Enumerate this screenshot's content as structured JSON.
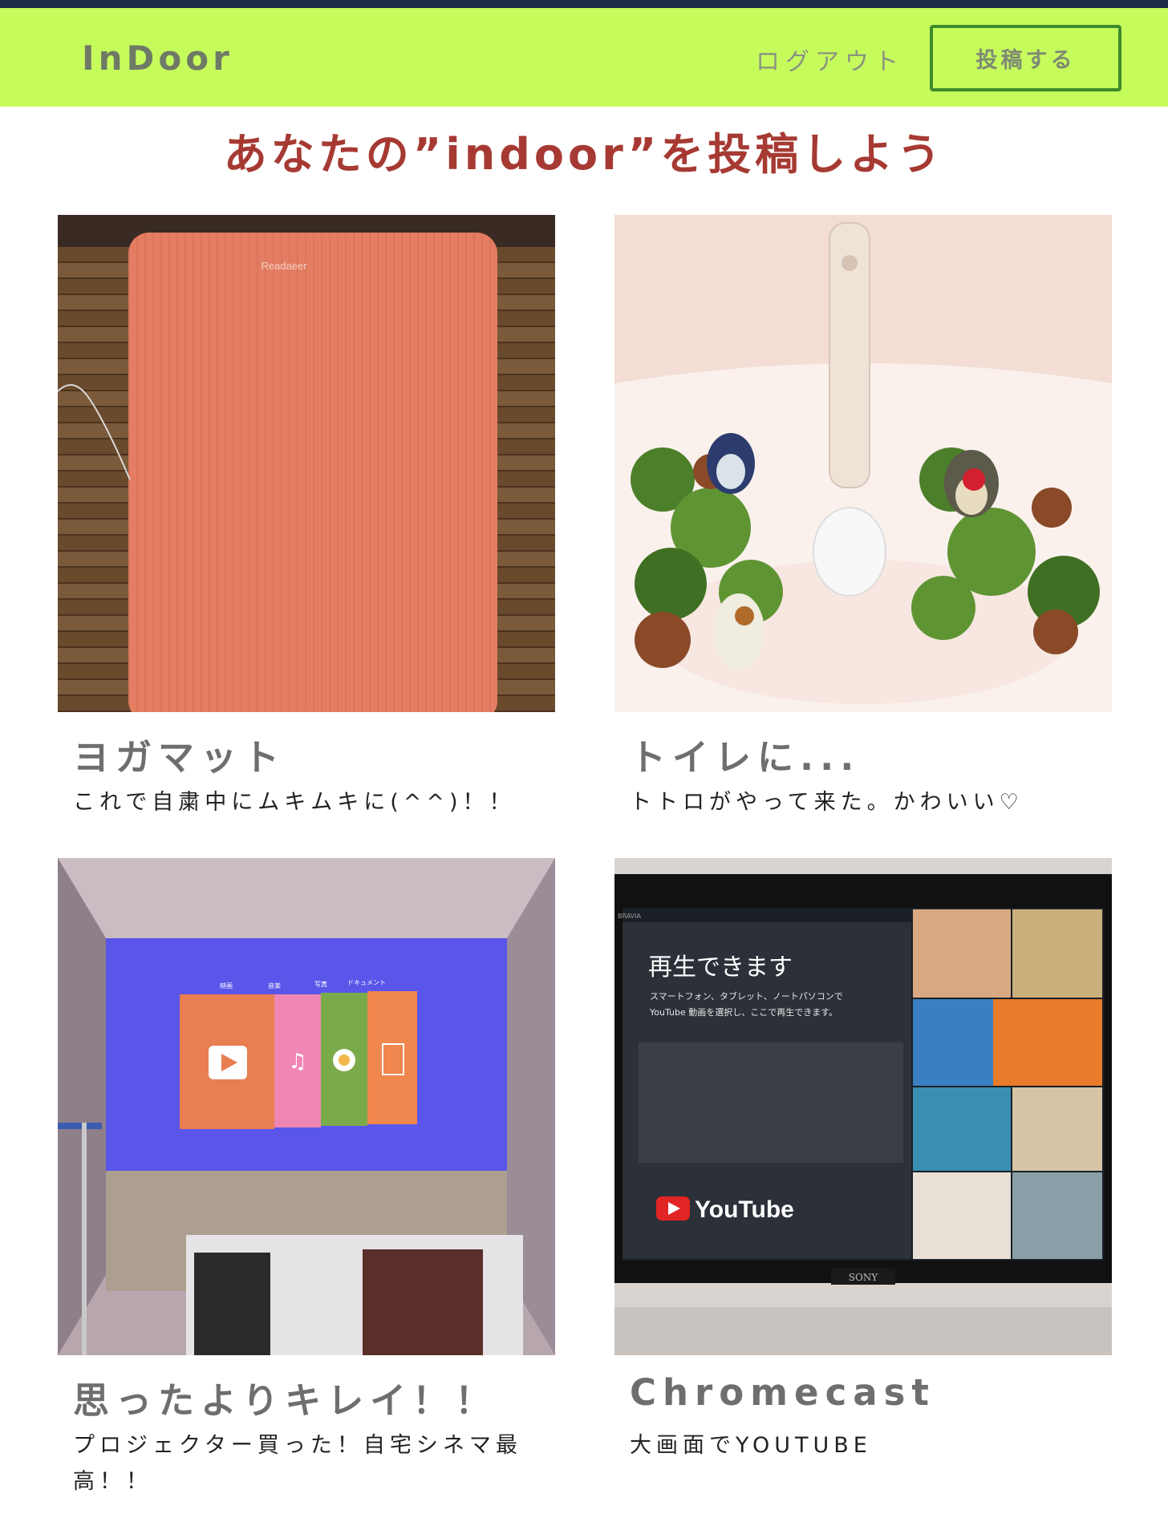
{
  "navbar": {
    "brand": "InDoor",
    "logout_label": "ログアウト",
    "post_label": "投稿する"
  },
  "headline": "あなたの”indoor”を投稿しよう",
  "posts": [
    {
      "title": "ヨガマット",
      "description": "これで自粛中にムキムキに(^^)！！"
    },
    {
      "title": "トイレに...",
      "description": "トトロがやって来た。かわいい♡"
    },
    {
      "title": "思ったよりキレイ！！",
      "description": "プロジェクター買った！自宅シネマ最高！！"
    },
    {
      "title": "Chromecast",
      "description": "大画面でYOUTUBE"
    }
  ],
  "photo_text": {
    "mat_brand": "Readaeer",
    "projector_tabs": [
      "映画",
      "音楽",
      "写真",
      "ドキュメント"
    ],
    "tv_headline": "再生できます",
    "tv_sub1": "スマートフォン、タブレット、ノートパソコンで",
    "tv_sub2": "YouTube 動画を選択し、ここで再生できます。",
    "tv_brand_top": "BRAVIA",
    "youtube_word": "YouTube",
    "tv_maker": "SONY"
  },
  "colors": {
    "navbar_bg": "#c6fb5c",
    "headline": "#a63a33",
    "button_border": "#3f8a2d"
  }
}
